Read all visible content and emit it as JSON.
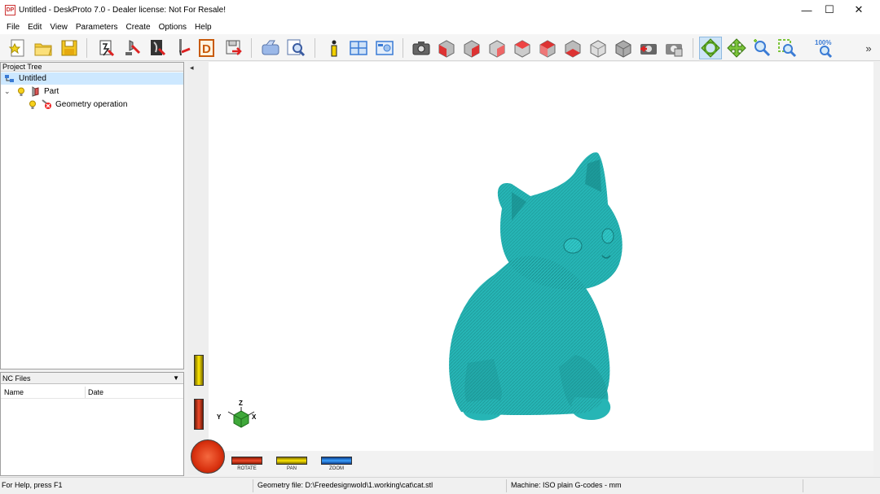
{
  "window": {
    "app_icon_text": "DP",
    "title": "Untitled - DeskProto 7.0 - Dealer license: Not For Resale!",
    "minimize_symbol": "—",
    "maximize_symbol": "☐",
    "close_symbol": "✕"
  },
  "menu": [
    "File",
    "Edit",
    "View",
    "Parameters",
    "Create",
    "Options",
    "Help"
  ],
  "toolbar": {
    "zoom_100_label": "100%",
    "overflow_symbol": "»",
    "icons": [
      "new-project-icon",
      "open-project-icon",
      "save-project-icon",
      "project-parameters-icon",
      "part-parameters-icon",
      "operation-parameters-icon",
      "tool-parameters-icon",
      "drawing-icon",
      "export-icon",
      "simulation-icon",
      "preview-icon",
      "info-icon",
      "views-icon",
      "render-icon",
      "camera-icon",
      "view-front-icon",
      "view-back-icon",
      "view-left-icon",
      "view-right-icon",
      "view-top-icon",
      "view-bottom-icon",
      "view-iso-icon",
      "view-iso2-icon",
      "reset-camera-icon",
      "camera-settings-icon",
      "rotate-mode-icon",
      "pan-mode-icon",
      "zoom-mode-icon",
      "zoom-window-icon",
      "zoom-100-icon"
    ]
  },
  "project_tree": {
    "header": "Project Tree",
    "root": "Untitled",
    "part": "Part",
    "operation": "Geometry operation",
    "expander": "⌄"
  },
  "nc_files": {
    "header": "NC Files",
    "dropdown_symbol": "▼",
    "columns": [
      "Name",
      "Date"
    ]
  },
  "viewport": {
    "collapse_symbol": "◂",
    "axis_labels": {
      "x": "X",
      "y": "Y",
      "z": "Z"
    },
    "model_color": "#26b5b5",
    "wheels": {
      "rotate": "ROTATE",
      "pan": "PAN",
      "zoom": "ZOOM"
    }
  },
  "statusbar": {
    "help": "For Help, press F1",
    "geometry": "Geometry file: D:\\Freedesignwold\\1.working\\cat\\cat.stl",
    "machine": "Machine: ISO plain G-codes - mm"
  },
  "colors": {
    "accent": "#3a7bd5",
    "selection": "#cde8ff",
    "model": "#26b5b5"
  }
}
